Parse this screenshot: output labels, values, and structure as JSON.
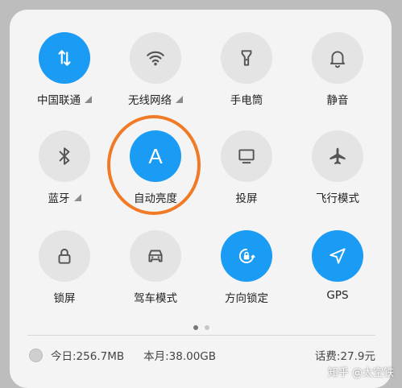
{
  "tiles": [
    {
      "label": "中国联通",
      "icon": "data-transfer-icon",
      "on": true,
      "arrow": true
    },
    {
      "label": "无线网络",
      "icon": "wifi-icon",
      "on": false,
      "arrow": true
    },
    {
      "label": "手电筒",
      "icon": "flashlight-icon",
      "on": false,
      "arrow": false
    },
    {
      "label": "静音",
      "icon": "bell-icon",
      "on": false,
      "arrow": false
    },
    {
      "label": "蓝牙",
      "icon": "bluetooth-icon",
      "on": false,
      "arrow": true
    },
    {
      "label": "自动亮度",
      "icon": "auto-brightness-icon",
      "glyph": "A",
      "on": true,
      "arrow": false
    },
    {
      "label": "投屏",
      "icon": "cast-screen-icon",
      "on": false,
      "arrow": false
    },
    {
      "label": "飞行模式",
      "icon": "airplane-icon",
      "on": false,
      "arrow": false
    },
    {
      "label": "锁屏",
      "icon": "lock-icon",
      "on": false,
      "arrow": false
    },
    {
      "label": "驾车模式",
      "icon": "car-icon",
      "on": false,
      "arrow": false
    },
    {
      "label": "方向锁定",
      "icon": "rotation-lock-icon",
      "on": true,
      "arrow": false
    },
    {
      "label": "GPS",
      "icon": "location-arrow-icon",
      "on": true,
      "arrow": false
    }
  ],
  "pager": {
    "count": 2,
    "active": 1
  },
  "footer": {
    "today": "今日:256.7MB",
    "month": "本月:38.00GB",
    "fee": "话费:27.9元"
  },
  "watermark": "知乎 @太空铁",
  "colors": {
    "active": "#1a9bf4",
    "inactive": "#e4e4e4",
    "highlight_ring": "#f07a26"
  }
}
